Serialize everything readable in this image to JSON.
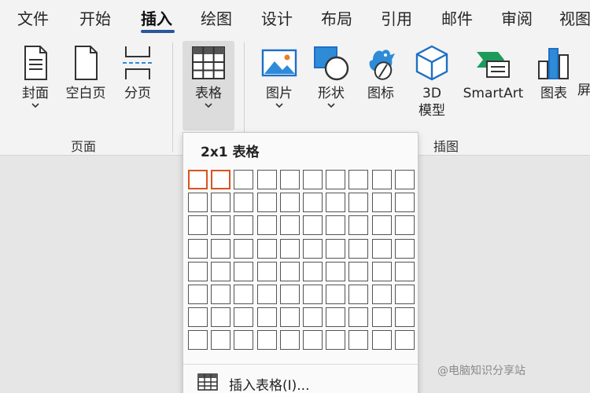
{
  "tabs": [
    "文件",
    "开始",
    "插入",
    "绘图",
    "设计",
    "布局",
    "引用",
    "邮件",
    "审阅",
    "视图"
  ],
  "active_tab": "插入",
  "accent_color": "#2b579a",
  "highlight_color": "#d9541f",
  "ribbon": {
    "pages_group": {
      "label": "页面",
      "buttons": [
        "封面",
        "空白页",
        "分页"
      ]
    },
    "table_button": "表格",
    "illustrations_group": {
      "label": "插图",
      "buttons": [
        "图片",
        "形状",
        "图标",
        "3D 模型",
        "SmartArt",
        "图表",
        "屏"
      ]
    }
  },
  "table_dropdown": {
    "title": "2x1 表格",
    "grid_columns": 10,
    "grid_rows": 8,
    "selected_columns": 2,
    "selected_rows": 1,
    "insert_table_label": "插入表格(I)..."
  },
  "watermark": "@电脑知识分享站"
}
